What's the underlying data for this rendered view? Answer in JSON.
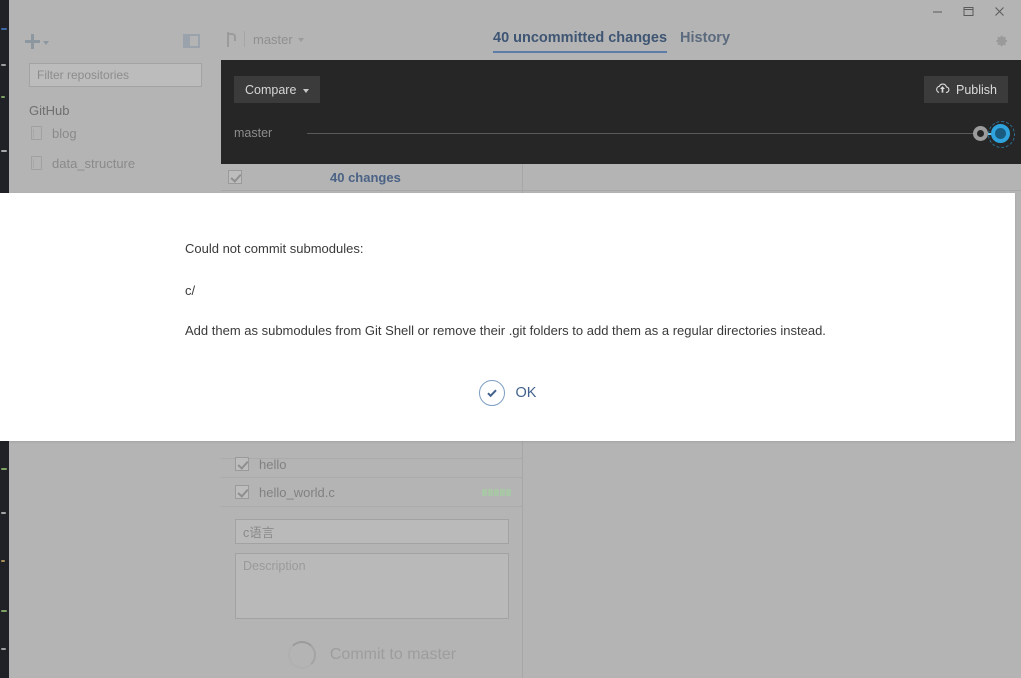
{
  "window": {
    "controls": [
      {
        "name": "minimize",
        "glyph": "minimize-icon"
      },
      {
        "name": "maximize",
        "glyph": "maximize-icon"
      },
      {
        "name": "close",
        "glyph": "close-icon"
      }
    ]
  },
  "sidebar": {
    "add_repo_label": "",
    "filter_placeholder": "Filter repositories",
    "group_title": "GitHub",
    "repositories": [
      {
        "name": "blog"
      },
      {
        "name": "data_structure"
      }
    ]
  },
  "topbar": {
    "branch_name": "master",
    "tabs": [
      {
        "label": "40 uncommitted changes",
        "active": true
      },
      {
        "label": "History",
        "active": false
      }
    ],
    "settings_icon": "gear-icon"
  },
  "graph": {
    "compare_label": "Compare",
    "publish_label": "Publish",
    "publish_icon": "cloud-upload-icon",
    "branch_label": "master"
  },
  "changes": {
    "count_label": "40 changes",
    "files": [
      {
        "name": "hello",
        "checked": true,
        "diff_blocks": 0
      },
      {
        "name": "hello_world.c",
        "checked": true,
        "diff_blocks": 5
      }
    ]
  },
  "commit_form": {
    "summary_value": "c语言",
    "description_placeholder": "Description",
    "commit_button_label": "Commit to master",
    "commit_spinner_icon": "spinner-icon"
  },
  "dialog": {
    "line1": "Could not commit submodules:",
    "line2": "c/",
    "line3": "Add them as submodules from Git Shell or remove their .git folders to add them as a regular directories instead.",
    "ok_label": "OK",
    "ok_icon": "check-circle-icon"
  },
  "colors": {
    "accent_blue": "#41628e",
    "tab_active": "#3e5573",
    "tab_underline": "#5d7ca8",
    "graph_bg": "#262626",
    "node_blue": "#2ea3dd",
    "diff_green": "#a9c6a6",
    "chrome_gray": "#b4b4b4"
  }
}
